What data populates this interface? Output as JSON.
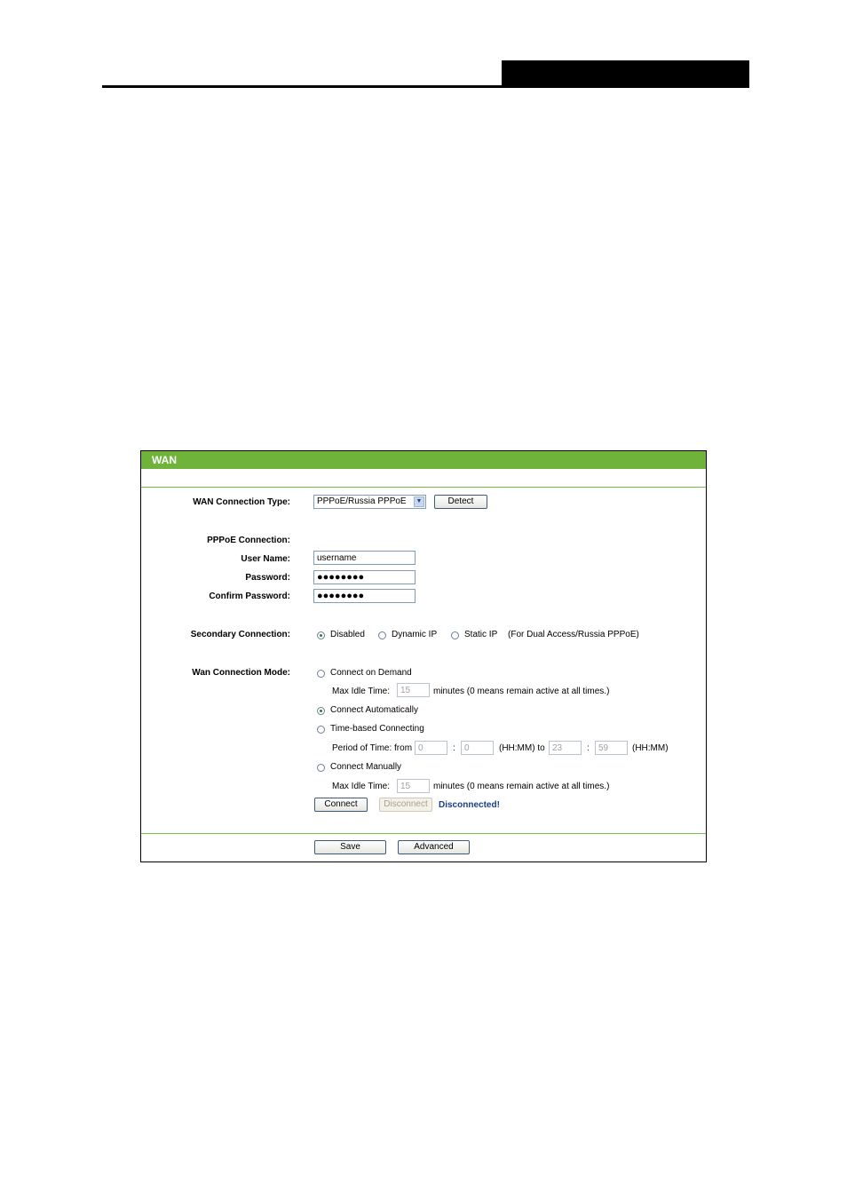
{
  "panel": {
    "title": "WAN"
  },
  "wan_type": {
    "label": "WAN Connection Type:",
    "selected": "PPPoE/Russia PPPoE",
    "detect": "Detect"
  },
  "pppoe": {
    "heading": "PPPoE Connection:",
    "user_label": "User Name:",
    "user_value": "username",
    "pass_label": "Password:",
    "pass_value": "●●●●●●●●",
    "confirm_label": "Confirm Password:",
    "confirm_value": "●●●●●●●●"
  },
  "secondary": {
    "label": "Secondary Connection:",
    "options": [
      "Disabled",
      "Dynamic IP",
      "Static IP"
    ],
    "selected": "Disabled",
    "note": "(For Dual Access/Russia PPPoE)"
  },
  "mode": {
    "label": "Wan Connection Mode:",
    "on_demand": "Connect on Demand",
    "idle_label": "Max Idle Time:",
    "idle_value": "15",
    "idle_note": "minutes (0 means remain active at all times.)",
    "auto": "Connect Automatically",
    "time_based": "Time-based Connecting",
    "period_label": "Period of Time: from",
    "from_h": "0",
    "from_m": "0",
    "sep": ":",
    "hhmm_to": "(HH:MM) to",
    "to_h": "23",
    "to_m": "59",
    "hhmm": "(HH:MM)",
    "manual": "Connect Manually",
    "manual_idle_label": "Max Idle Time:",
    "manual_idle_value": "15",
    "manual_idle_note": "minutes (0 means remain active at all times.)",
    "selected": "Connect Automatically"
  },
  "actions": {
    "connect": "Connect",
    "disconnect": "Disconnect",
    "status": "Disconnected!"
  },
  "footer": {
    "save": "Save",
    "advanced": "Advanced"
  }
}
